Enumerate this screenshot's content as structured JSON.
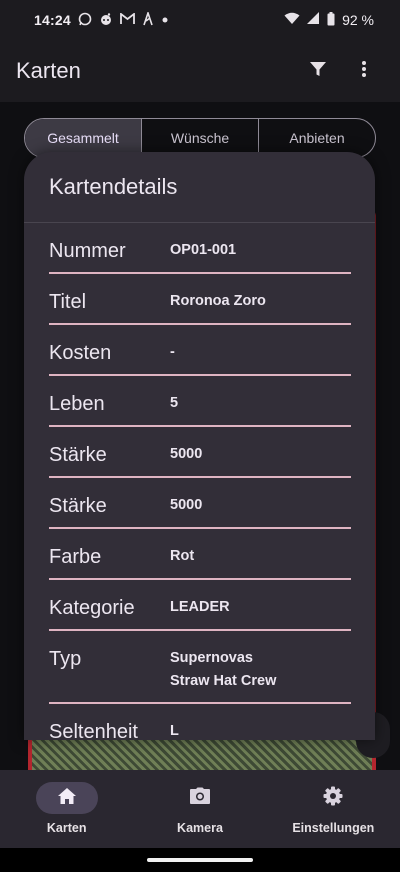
{
  "status_bar": {
    "time": "14:24",
    "battery": "92 %",
    "icons_left": [
      "whatsapp-icon",
      "reddit-icon",
      "gmail-icon",
      "app-icon",
      "dot-icon"
    ],
    "icons_right": [
      "wifi-icon",
      "signal-icon",
      "battery-icon"
    ]
  },
  "appbar": {
    "title": "Karten",
    "actions": [
      "filter-icon",
      "more-vert-icon"
    ]
  },
  "segments": [
    {
      "label": "Gesammelt",
      "active": true
    },
    {
      "label": "Wünsche",
      "active": false
    },
    {
      "label": "Anbieten",
      "active": false
    }
  ],
  "sheet": {
    "title": "Kartendetails",
    "rows": [
      {
        "label": "Nummer",
        "values": [
          "OP01-001"
        ]
      },
      {
        "label": "Titel",
        "values": [
          "Roronoa Zoro"
        ]
      },
      {
        "label": "Kosten",
        "values": [
          "-"
        ]
      },
      {
        "label": "Leben",
        "values": [
          "5"
        ]
      },
      {
        "label": "Stärke",
        "values": [
          "5000"
        ]
      },
      {
        "label": "Stärke",
        "values": [
          "5000"
        ]
      },
      {
        "label": "Farbe",
        "values": [
          "Rot"
        ]
      },
      {
        "label": "Kategorie",
        "values": [
          "LEADER"
        ]
      },
      {
        "label": "Typ",
        "values": [
          "Supernovas",
          "Straw Hat Crew"
        ]
      },
      {
        "label": "Seltenheit",
        "values": [
          "L"
        ]
      }
    ]
  },
  "nav": [
    {
      "label": "Karten",
      "icon": "home-icon",
      "active": true
    },
    {
      "label": "Kamera",
      "icon": "camera-icon",
      "active": false
    },
    {
      "label": "Einstellungen",
      "icon": "settings-icon",
      "active": false
    }
  ],
  "colors": {
    "background": "#1c1b1f",
    "sheet": "#322e38",
    "divider": "#dfb4c2",
    "card_red": "#b3262e",
    "nav_active": "#4a4458"
  }
}
